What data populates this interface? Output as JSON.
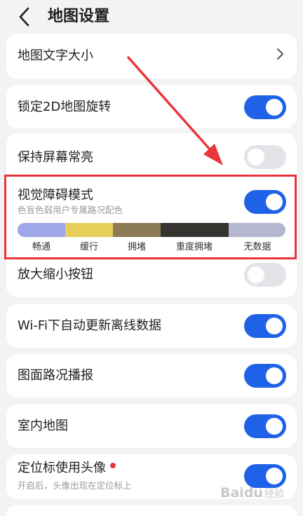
{
  "header": {
    "title": "地图设置",
    "back_icon": "chevron-left-icon"
  },
  "settings": {
    "map_text_size": {
      "label": "地图文字大小"
    },
    "lock_2d_rotation": {
      "label": "锁定2D地图旋转",
      "enabled": true
    },
    "keep_screen_on": {
      "label": "保持屏幕常亮",
      "enabled": false
    },
    "visual_impairment_mode": {
      "label": "视觉障碍模式",
      "subtitle": "色盲色弱用户专属路况配色",
      "enabled": true,
      "legend": [
        {
          "label": "畅通",
          "color": "#9ea7e8"
        },
        {
          "label": "缓行",
          "color": "#e7cd5a"
        },
        {
          "label": "拥堵",
          "color": "#8c7c55"
        },
        {
          "label": "重度拥堵",
          "color": "#363431"
        },
        {
          "label": "无数据",
          "color": "#b4b6d2"
        }
      ]
    },
    "zoom_buttons": {
      "label": "放大缩小按钮",
      "enabled": false
    },
    "wifi_offline_update": {
      "label": "Wi-Fi下自动更新离线数据",
      "enabled": true
    },
    "road_broadcast": {
      "label": "图面路况播报",
      "enabled": true
    },
    "indoor_map": {
      "label": "室内地图",
      "enabled": true
    },
    "avatar_locator": {
      "label": "定位标使用头像",
      "subtitle": "开启后，头像出现在定位标上",
      "enabled": true
    }
  },
  "watermark": {
    "brand": "Baidu",
    "suffix": "经验"
  },
  "colors": {
    "accent": "#1f62e8",
    "highlight": "#e8363b",
    "background": "#f1f3f5"
  }
}
